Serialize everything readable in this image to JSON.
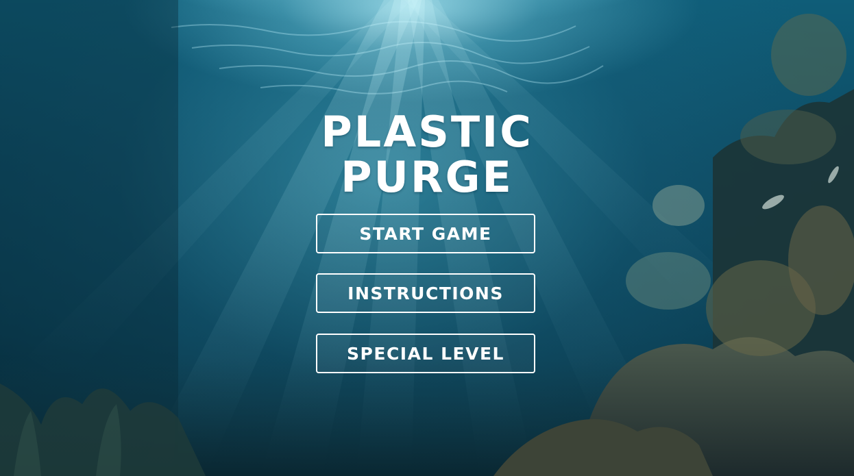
{
  "game": {
    "title_line1": "PLASTIC",
    "title_line2": "PURGE"
  },
  "menu": {
    "start_label": "START GAME",
    "instructions_label": "INSTRUCTIONS",
    "special_label": "SPECIAL LEVEL"
  },
  "colors": {
    "text": "#ffffff",
    "water_light": "#8fdcec",
    "water_mid": "#1a6f8c",
    "water_deep": "#082d3c",
    "reef": "#4a4a3c"
  }
}
